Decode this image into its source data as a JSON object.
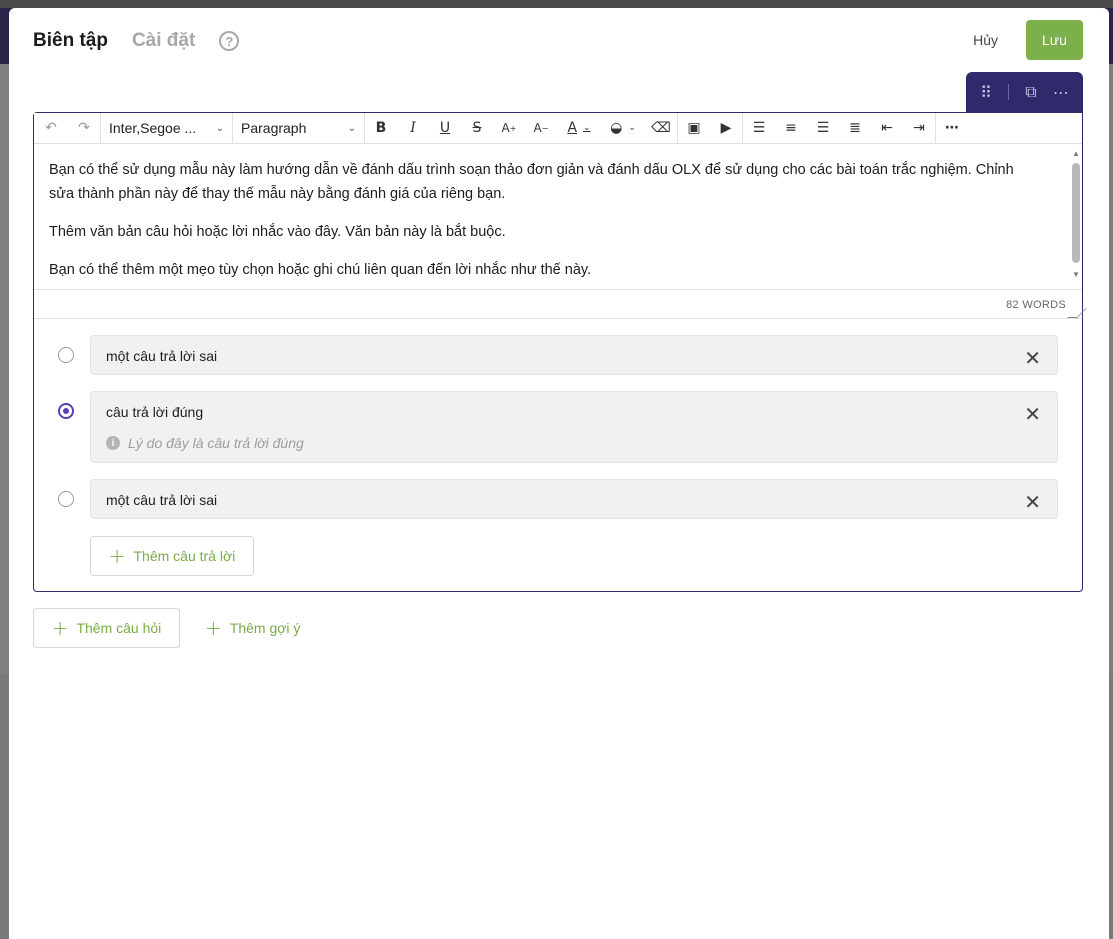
{
  "tabs": [
    {
      "label": "Biên tập",
      "active": true
    },
    {
      "label": "Cài đặt",
      "active": false
    }
  ],
  "help_icon": "question-circle-icon",
  "actions": {
    "cancel_label": "Hủy",
    "save_label": "Lưu"
  },
  "colors": {
    "accent": "#2f2a6b",
    "save": "#7bb04a",
    "link": "#78ac46",
    "radio_checked": "#5a3fb0"
  },
  "block_tools": [
    "drag-handle-icon",
    "duplicate-icon",
    "more-options-icon"
  ],
  "toolbar": {
    "font_family": "Inter,Segoe ...",
    "block_format": "Paragraph",
    "buttons": [
      "undo",
      "redo",
      "bold",
      "italic",
      "underline",
      "strikethrough",
      "superscript",
      "subscript",
      "text-color",
      "highlight-color",
      "clear-formatting",
      "insert-image",
      "insert-video",
      "align-left",
      "align-center",
      "align-right",
      "justify",
      "outdent",
      "indent",
      "more"
    ]
  },
  "editor": {
    "paragraphs": [
      "Bạn có thể sử dụng mẫu này làm hướng dẫn về đánh dấu trình soạn thảo đơn giản và đánh dấu OLX để sử dụng cho các bài toán trắc nghiệm. Chỉnh sửa thành phần này để thay thế mẫu này bằng đánh giá của riêng bạn.",
      "Thêm văn bản câu hỏi hoặc lời nhắc vào đây. Văn bản này là bắt buộc.",
      "Bạn có thể thêm một mẹo tùy chọn hoặc ghi chú liên quan đến lời nhắc như thế này."
    ],
    "word_count": "82 WORDS"
  },
  "answers": [
    {
      "text": "một câu trả lời sai",
      "correct": false
    },
    {
      "text": "câu trả lời đúng",
      "correct": true,
      "feedback_placeholder": "Lý do đây là câu trả lời đúng"
    },
    {
      "text": "một câu trả lời sai",
      "correct": false
    }
  ],
  "add_answer_label": "Thêm câu trả lời",
  "add_question_label": "Thêm câu hỏi",
  "add_hint_label": "Thêm gợi ý"
}
